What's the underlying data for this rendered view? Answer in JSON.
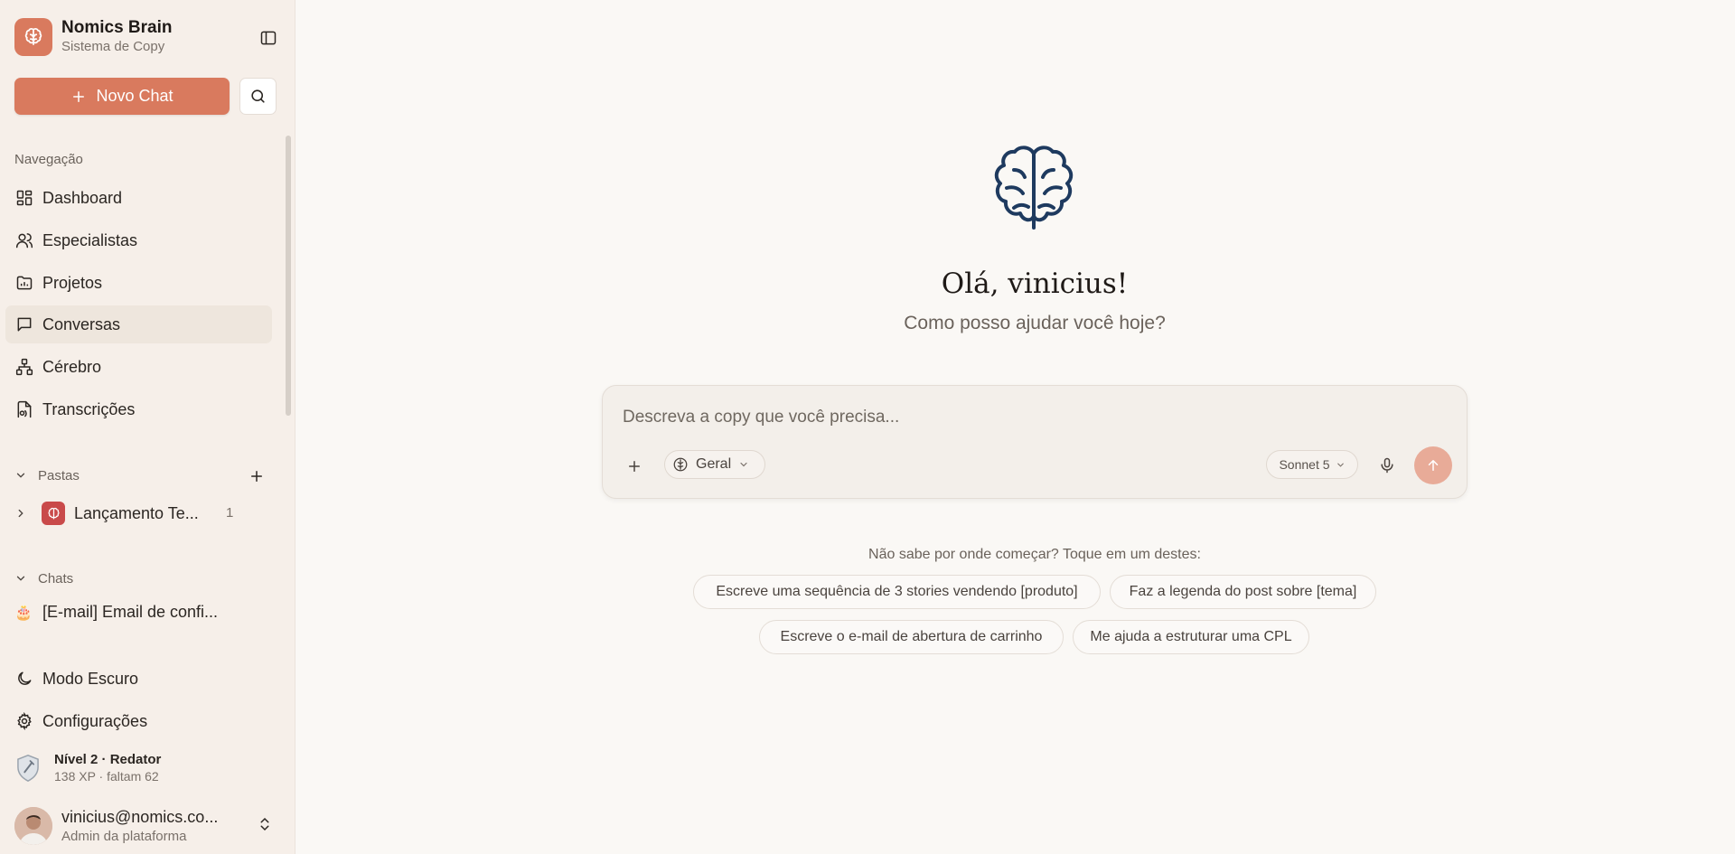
{
  "brand": {
    "title": "Nomics Brain",
    "subtitle": "Sistema de Copy"
  },
  "sidebar": {
    "new_chat_label": "Novo Chat",
    "nav_section_label": "Navegação",
    "nav": [
      {
        "label": "Dashboard",
        "icon": "dashboard-icon"
      },
      {
        "label": "Especialistas",
        "icon": "users-icon"
      },
      {
        "label": "Projetos",
        "icon": "folder-icon"
      },
      {
        "label": "Conversas",
        "icon": "chat-bubble-icon",
        "active": true
      },
      {
        "label": "Cérebro",
        "icon": "network-icon"
      },
      {
        "label": "Transcrições",
        "icon": "transcription-icon"
      }
    ],
    "folders_label": "Pastas",
    "folders": [
      {
        "label": "Lançamento Te...",
        "count": "1"
      }
    ],
    "chats_label": "Chats",
    "chats": [
      {
        "emoji": "🎂",
        "label": "[E-mail] Email de confi..."
      }
    ],
    "dark_mode_label": "Modo Escuro",
    "settings_label": "Configurações",
    "level": {
      "title": "Nível 2 · Redator",
      "sub": "138 XP · faltam 62"
    },
    "user": {
      "email": "vinicius@nomics.co...",
      "role": "Admin da plataforma"
    }
  },
  "main": {
    "greeting": "Olá, vinicius!",
    "subtitle": "Como posso ajudar você hoje?",
    "composer": {
      "placeholder": "Descreva a copy que você precisa...",
      "mode": "Geral",
      "model": "Sonnet 5"
    },
    "suggest_heading": "Não sabe por onde começar? Toque em um destes:",
    "suggestions": [
      "Escreve uma sequência de 3 stories vendendo [produto]",
      "Faz a legenda do post sobre [tema]",
      "Escreve o e-mail de abertura de carrinho",
      "Me ajuda a estruturar uma CPL"
    ]
  },
  "colors": {
    "accent": "#d97a5e",
    "send_disabled": "#e8ab98",
    "brain_stroke": "#1e3a5f"
  }
}
